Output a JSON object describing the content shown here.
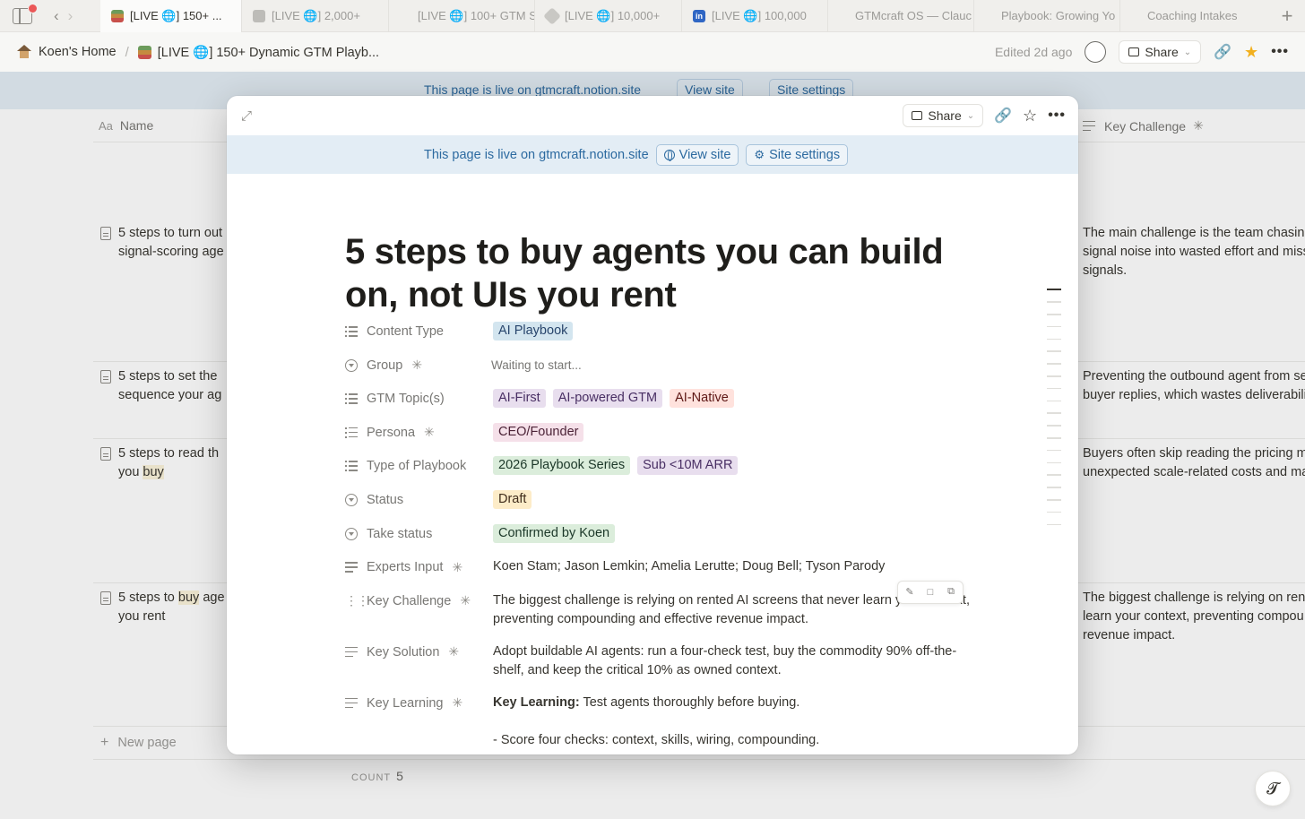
{
  "tabs": [
    {
      "label": "[LIVE 🌐] 150+ ...",
      "icon": "books-icon",
      "active": true
    },
    {
      "label": "[LIVE 🌐] 2,000+",
      "icon": "microphone-icon"
    },
    {
      "label": "[LIVE 🌐] 100+ GTM S",
      "icon": ""
    },
    {
      "label": "[LIVE 🌐] 10,000+",
      "icon": "tag-icon"
    },
    {
      "label": "[LIVE 🌐] 100,000",
      "icon": "linkedin-icon"
    },
    {
      "label": "GTMcraft OS — Clauc",
      "icon": ""
    },
    {
      "label": "Playbook: Growing Yo",
      "icon": ""
    },
    {
      "label": "Coaching Intakes",
      "icon": ""
    }
  ],
  "topbar": {
    "home": "Koen's Home",
    "page": "[LIVE 🌐] 150+ Dynamic GTM Playb...",
    "edited": "Edited 2d ago",
    "share": "Share"
  },
  "site_banner": {
    "text": "This page is live on gtmcraft.notion.site",
    "view_site": "View site",
    "site_settings": "Site settings"
  },
  "table": {
    "name_header": "Name",
    "challenge_header": "Key Challenge",
    "rows": [
      {
        "name_l1": "5 steps to turn out",
        "name_l2": "signal-scoring age",
        "chal": [
          "The main challenge is the team chasing",
          "signal noise into wasted effort and miss",
          "signals."
        ]
      },
      {
        "name_l1": "5 steps to set the",
        "name_l2": "sequence your ag",
        "chal": [
          "Preventing the outbound agent from se",
          "buyer replies, which wastes deliverabili"
        ]
      },
      {
        "name_l1": "5 steps to read th",
        "name_l2a": "you ",
        "name_l2b": "buy",
        "chal": [
          "Buyers often skip reading the pricing m",
          "unexpected scale-related costs and ma"
        ]
      },
      {
        "name_l1a": "5 steps to ",
        "name_l1b": "buy",
        "name_l1c": " age",
        "name_l2": "you rent",
        "chal": [
          "The biggest challenge is relying on rent",
          "learn your context, preventing compou",
          "revenue impact."
        ]
      }
    ],
    "new_page": "New page",
    "count_label": "COUNT",
    "count_value": "5"
  },
  "modal": {
    "share": "Share",
    "title": "5 steps to buy agents you can build on, not UIs you rent",
    "properties": {
      "content_type": {
        "label": "Content Type",
        "tags": [
          "AI Playbook"
        ]
      },
      "group": {
        "label": "Group",
        "value": "Waiting to start..."
      },
      "gtm_topics": {
        "label": "GTM Topic(s)",
        "tags": [
          "AI-First",
          "AI-powered GTM",
          "AI-Native"
        ]
      },
      "persona": {
        "label": "Persona",
        "tags": [
          "CEO/Founder"
        ]
      },
      "type_of_playbook": {
        "label": "Type of Playbook",
        "tags": [
          "2026 Playbook Series",
          "Sub <10M ARR"
        ]
      },
      "status": {
        "label": "Status",
        "value": "Draft"
      },
      "take_status": {
        "label": "Take status",
        "value": "Confirmed by Koen"
      },
      "experts_input": {
        "label": "Experts Input",
        "value": "Koen Stam; Jason Lemkin; Amelia Lerutte; Doug Bell; Tyson Parody"
      },
      "key_challenge": {
        "label": "Key Challenge",
        "value": "The biggest challenge is relying on rented AI screens that never learn your context, preventing compounding and effective revenue impact."
      },
      "key_solution": {
        "label": "Key Solution",
        "value": "Adopt buildable AI agents: run a four-check test, buy the commodity 90% off-the-shelf, and keep the critical 10% as owned context."
      },
      "key_learning": {
        "label": "Key Learning",
        "bold": "Key Learning:",
        "value": " Test agents thoroughly before buying.",
        "bullet": "- Score four checks: context, skills, wiring, compounding."
      }
    }
  },
  "colors": {
    "tag_blue": "#d3e5ef",
    "tag_purple": "#e8deee",
    "tag_red": "#ffe2dd",
    "tag_pink": "#f5e0e9",
    "tag_green": "#dbeddb",
    "tag_yellow": "#fdecc8",
    "banner_bg": "#e3edf5",
    "banner_text": "#2c6aa0"
  }
}
